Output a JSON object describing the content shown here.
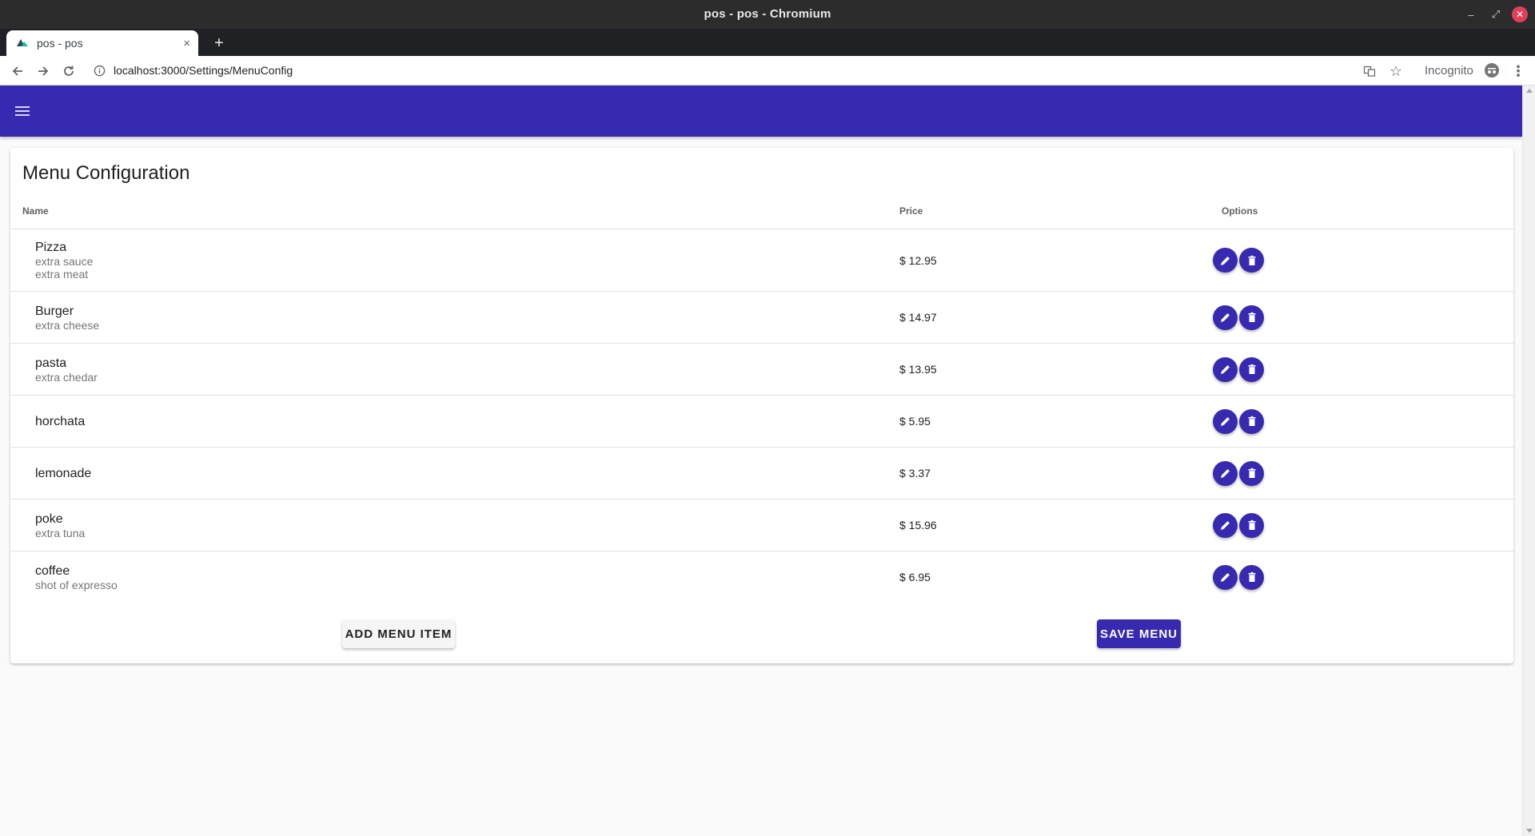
{
  "window": {
    "title": "pos - pos - Chromium",
    "controls": {
      "minimize": "–",
      "maximize": "⤢",
      "close": "✕"
    }
  },
  "browser": {
    "tab_title": "pos - pos",
    "tab_close": "×",
    "new_tab": "+",
    "url": "localhost:3000/Settings/MenuConfig",
    "incognito_label": "Incognito",
    "kebab": "⋮",
    "star": "☆"
  },
  "page": {
    "title": "Menu Configuration",
    "columns": {
      "name": "Name",
      "price": "Price",
      "options": "Options"
    },
    "items": [
      {
        "name": "Pizza",
        "extras": [
          "extra sauce",
          "extra meat"
        ],
        "price": "$ 12.95"
      },
      {
        "name": "Burger",
        "extras": [
          "extra cheese"
        ],
        "price": "$ 14.97"
      },
      {
        "name": "pasta",
        "extras": [
          "extra chedar"
        ],
        "price": "$ 13.95"
      },
      {
        "name": "horchata",
        "extras": [],
        "price": "$ 5.95"
      },
      {
        "name": "lemonade",
        "extras": [],
        "price": "$ 3.37"
      },
      {
        "name": "poke",
        "extras": [
          "extra tuna"
        ],
        "price": "$ 15.96"
      },
      {
        "name": "coffee",
        "extras": [
          "shot of expresso"
        ],
        "price": "$ 6.95"
      }
    ],
    "add_button": "ADD MENU ITEM",
    "save_button": "SAVE MENU"
  },
  "colors": {
    "primary": "#3729b0",
    "titlebar": "#2c2c2c",
    "tabstrip": "#202124"
  }
}
